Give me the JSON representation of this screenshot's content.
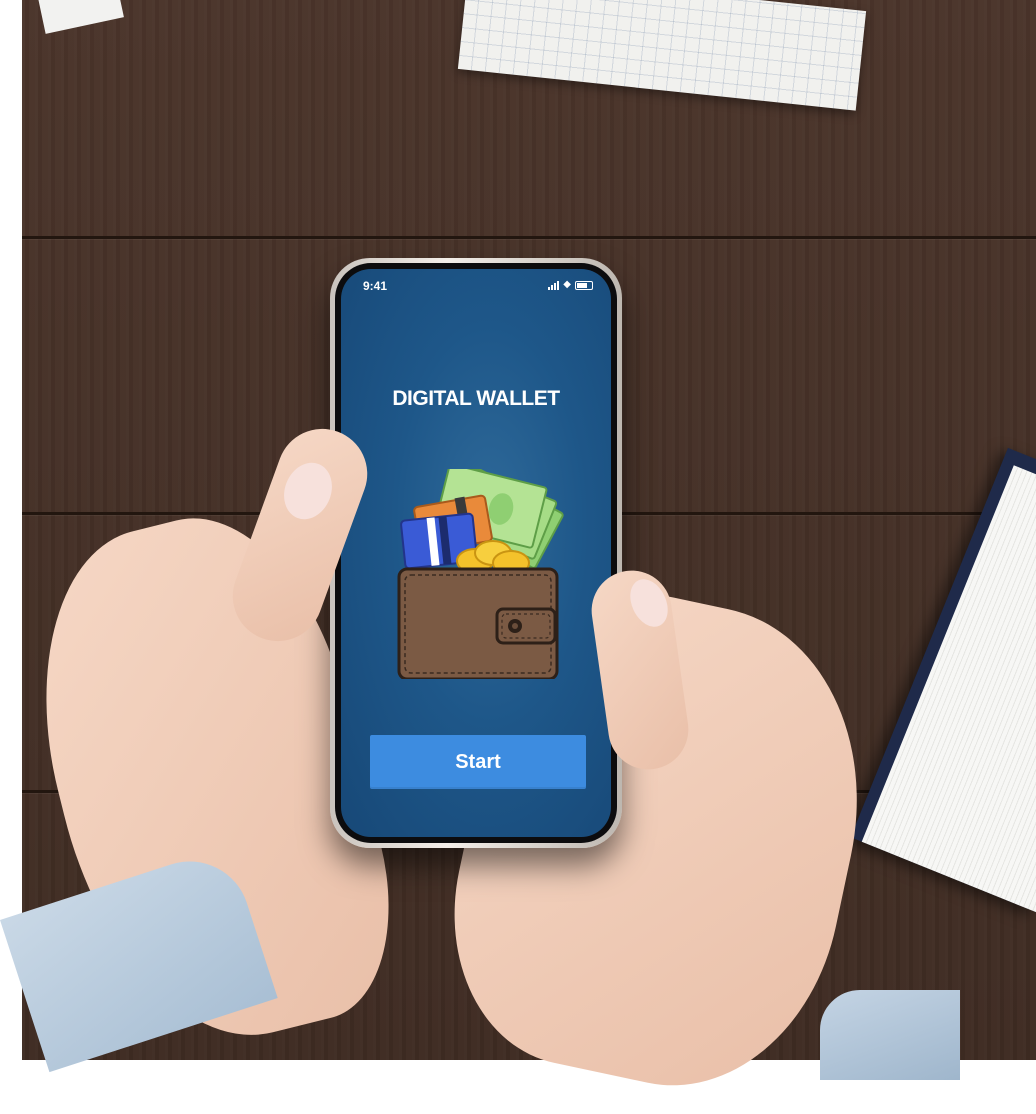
{
  "status_bar": {
    "time": "9:41"
  },
  "app": {
    "title": "DIGITAL WALLET",
    "start_label": "Start"
  },
  "icons": {
    "signal": "signal-icon",
    "wifi": "wifi-icon",
    "battery": "battery-icon",
    "wallet": "wallet-icon"
  },
  "colors": {
    "screen_bg": "#1e5789",
    "button_bg": "#3d8ce0",
    "wallet_brown": "#7b5a44"
  }
}
